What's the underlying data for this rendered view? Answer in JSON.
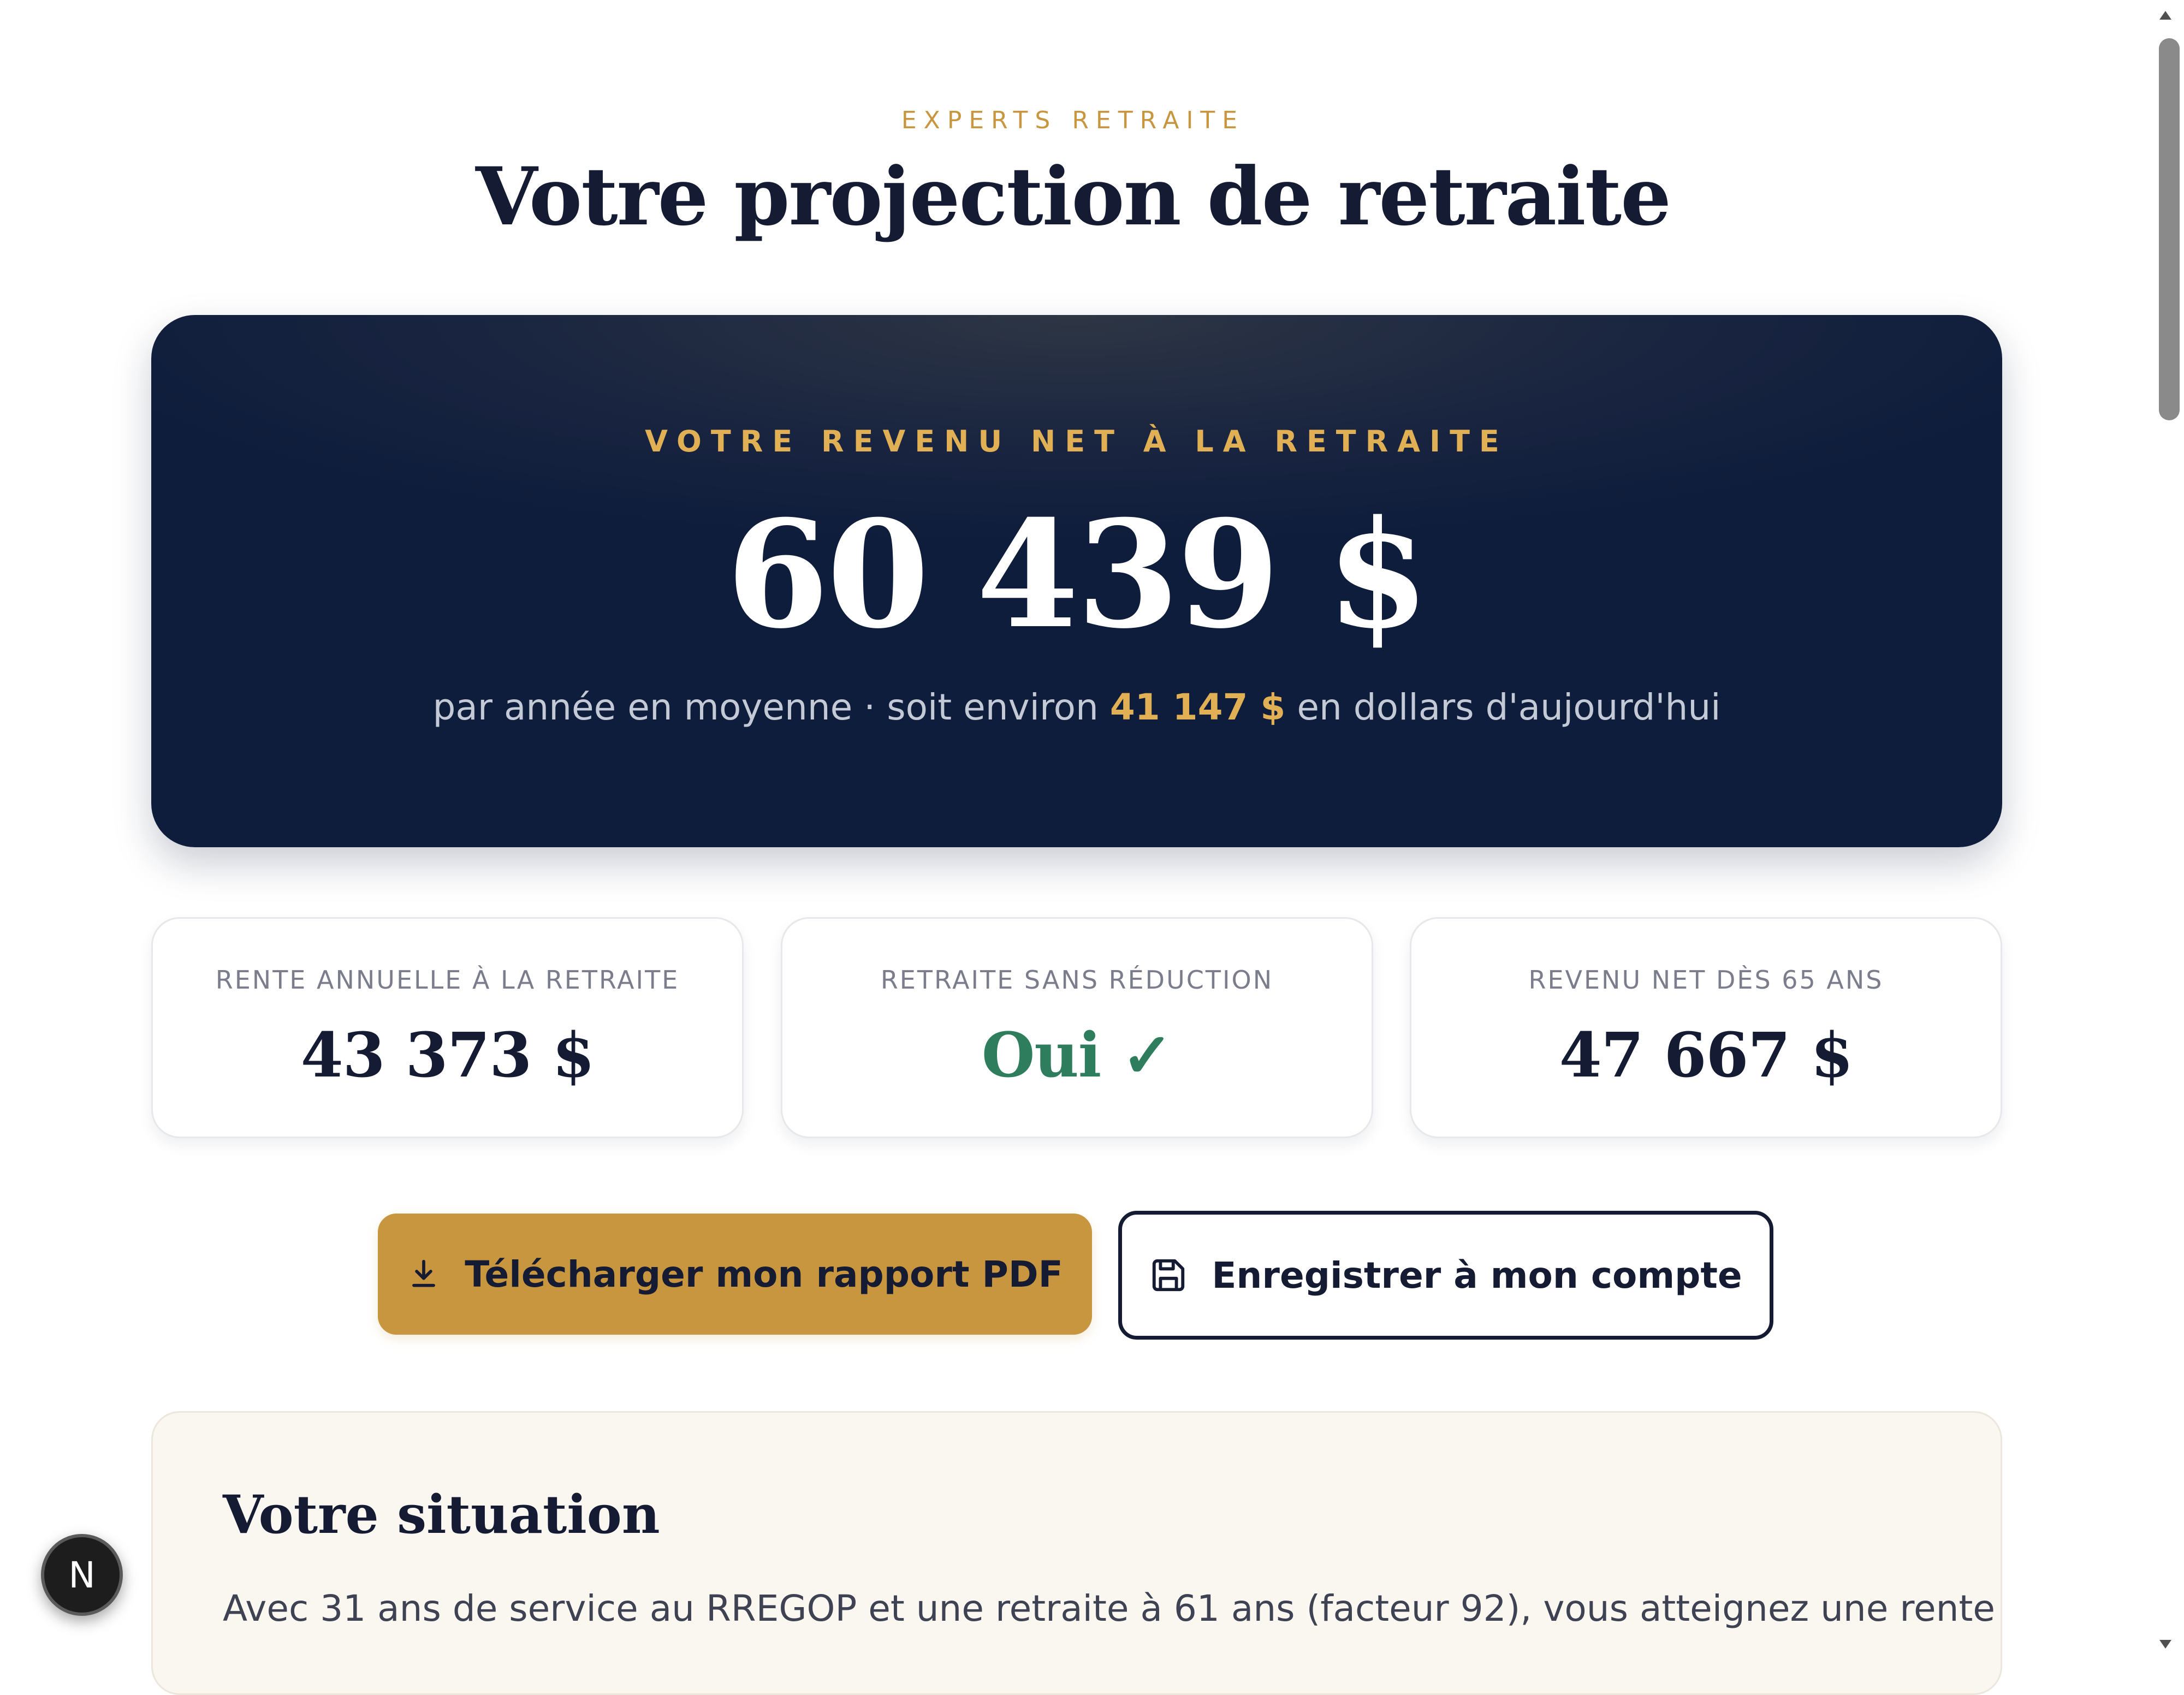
{
  "header": {
    "eyebrow": "EXPERTS RETRAITE",
    "title": "Votre projection de retraite"
  },
  "hero": {
    "label": "VOTRE REVENU NET À LA RETRAITE",
    "value": "60 439 $",
    "sub_prefix": "par année en moyenne · soit environ ",
    "sub_highlight": "41 147 $",
    "sub_suffix": " en dollars d'aujourd'hui"
  },
  "stats": [
    {
      "label": "RENTE ANNUELLE À LA RETRAITE",
      "value": "43 373 $"
    },
    {
      "label": "RETRAITE SANS RÉDUCTION",
      "value": "Oui ✓"
    },
    {
      "label": "REVENU NET DÈS 65 ANS",
      "value": "47 667 $"
    }
  ],
  "actions": {
    "download_label": "Télécharger mon rapport PDF",
    "download_icon": "download-icon",
    "save_label": "Enregistrer à mon compte",
    "save_icon": "floppy-disk-icon"
  },
  "situation": {
    "title": "Votre situation",
    "text": "Avec 31 ans de service au RREGOP et une retraite à 61 ans (facteur 92), vous atteignez une rente"
  },
  "dev_badge": {
    "letter": "N"
  },
  "colors": {
    "gold": "#c8963e",
    "navy": "#0e1d3c",
    "success": "#2e7d5c"
  }
}
